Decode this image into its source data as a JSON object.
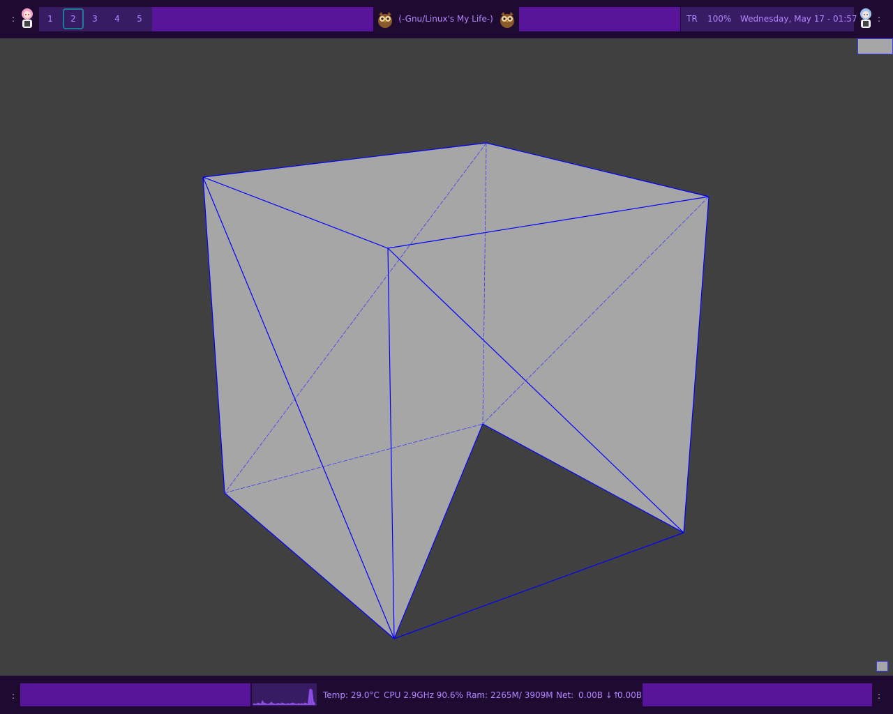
{
  "top_bar": {
    "left_dots": ":",
    "right_dots": ":",
    "workspaces": [
      "1",
      "2",
      "3",
      "4",
      "5"
    ],
    "active_workspace": "2",
    "window_title": "(-Gnu/Linux's My Life-)",
    "keyboard_layout": "TR",
    "volume": "100%",
    "datetime": "Wednesday, May 17 - 01:57"
  },
  "bottom_bar": {
    "left_dots": ":",
    "right_dots": ":",
    "temp": "Temp: 29.0°C",
    "cpu": "CPU 2.9GHz 90.6%",
    "ram": "Ram: 2265M/ 3909M",
    "net_label": "Net:",
    "net_down": "0.00B ↓↑",
    "net_up": "0.00B",
    "cpu_history": [
      3,
      2,
      2,
      4,
      3,
      2,
      8,
      4,
      3,
      2,
      2,
      3,
      5,
      3,
      2,
      2,
      3,
      3,
      2,
      4,
      3,
      2,
      2,
      3,
      2,
      3,
      4,
      3,
      2,
      2,
      3,
      2,
      3,
      2,
      4,
      3,
      2,
      25,
      26,
      24,
      5,
      3
    ]
  },
  "icons": {
    "avatar_left": "pink-haired-maid-avatar-icon",
    "avatar_right": "blue-haired-maid-avatar-icon",
    "owl": "owl-icon"
  },
  "colors": {
    "bar_bg": "#1f0b32",
    "accent_purple": "#58149a",
    "text_purple": "#b486ff",
    "desktop_bg": "#404040",
    "cube_face": "#a6a6a6",
    "cube_edge": "#0000ff"
  }
}
